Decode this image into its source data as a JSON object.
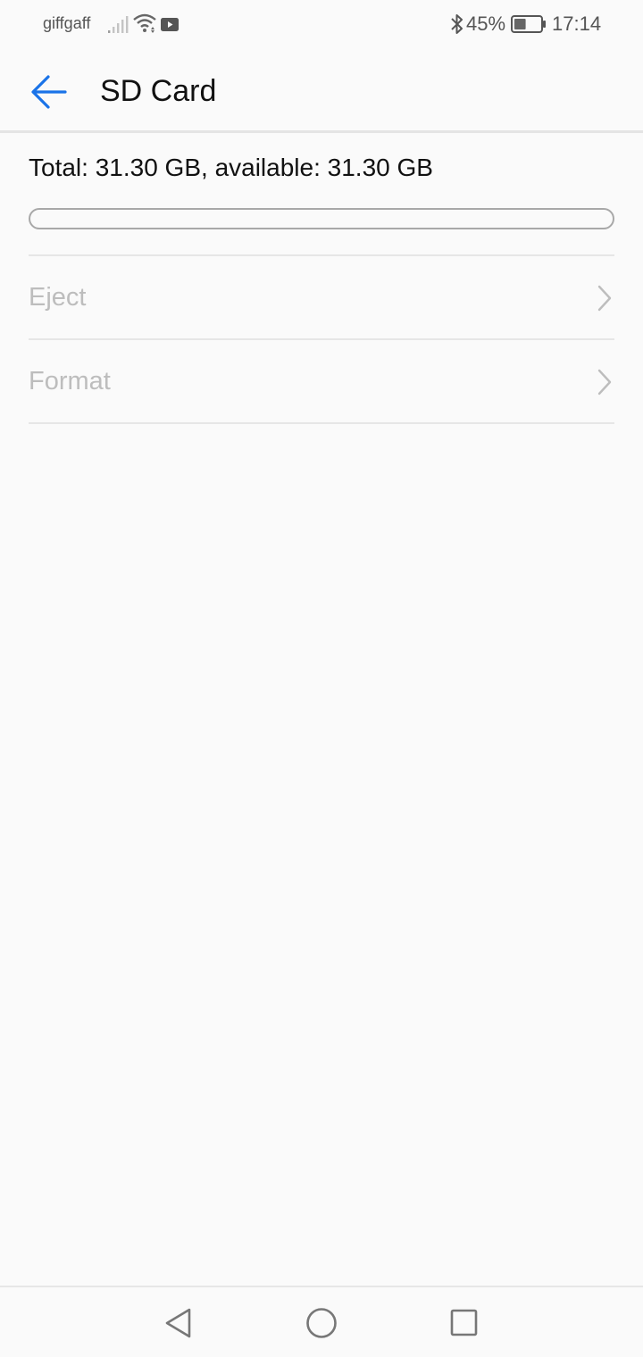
{
  "status_bar": {
    "carrier": "giffgaff",
    "battery_percent": "45%",
    "battery_level": 0.45,
    "time": "17:14",
    "icons": [
      "signal-icon",
      "wifi-icon",
      "video-icon",
      "bluetooth-icon",
      "battery-icon"
    ]
  },
  "header": {
    "title": "SD Card",
    "back_icon": "arrow-left-icon",
    "accent_color": "#1a73e8"
  },
  "storage": {
    "summary": "Total: 31.30 GB, available: 31.30 GB",
    "used_fraction": 0.0
  },
  "items": [
    {
      "label": "Eject",
      "icon": "chevron-right-icon",
      "enabled": false
    },
    {
      "label": "Format",
      "icon": "chevron-right-icon",
      "enabled": false
    }
  ],
  "nav_bar": {
    "icons": [
      "nav-back-icon",
      "nav-home-icon",
      "nav-recents-icon"
    ]
  }
}
